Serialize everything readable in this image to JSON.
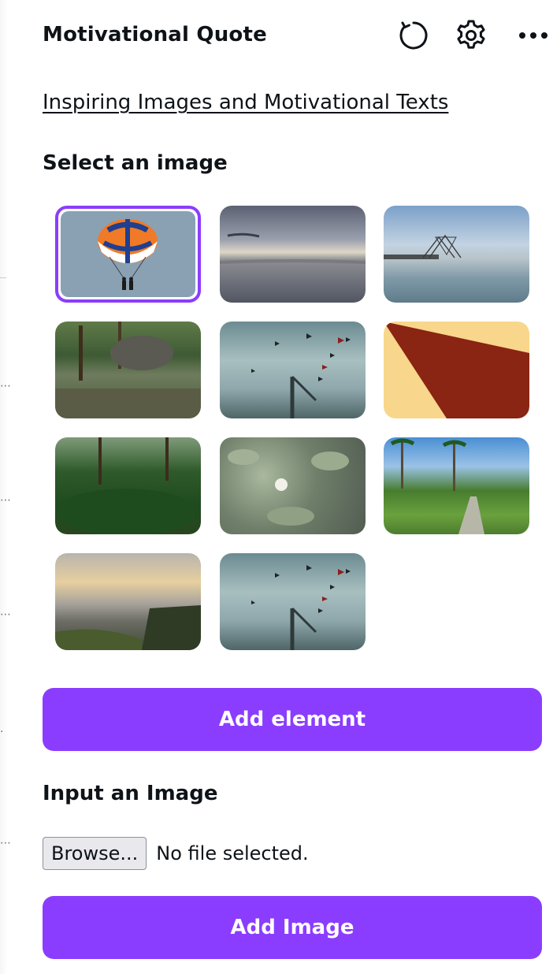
{
  "header": {
    "title": "Motivational Quote",
    "icons": [
      "refresh-icon",
      "gear-icon",
      "more-icon"
    ]
  },
  "section_link": "Inspiring Images and Motivational Texts",
  "select_image": {
    "label": "Select an image",
    "selected_index": 0,
    "images": [
      {
        "name": "parasail-image"
      },
      {
        "name": "sea-dusk-image"
      },
      {
        "name": "fishing-nets-image"
      },
      {
        "name": "jungle-pond-image"
      },
      {
        "name": "birds-sky-image"
      },
      {
        "name": "abstract-triangles-image"
      },
      {
        "name": "forest-image"
      },
      {
        "name": "water-lilies-image"
      },
      {
        "name": "rice-terrace-image"
      },
      {
        "name": "cliff-sunset-image"
      },
      {
        "name": "birds-sky-image-2"
      }
    ]
  },
  "add_element_label": "Add element",
  "input_image": {
    "label": "Input an Image",
    "browse_label": "Browse...",
    "status": "No file selected."
  },
  "add_image_label": "Add Image",
  "colors": {
    "accent": "#8b3dff",
    "text": "#0e1318"
  }
}
